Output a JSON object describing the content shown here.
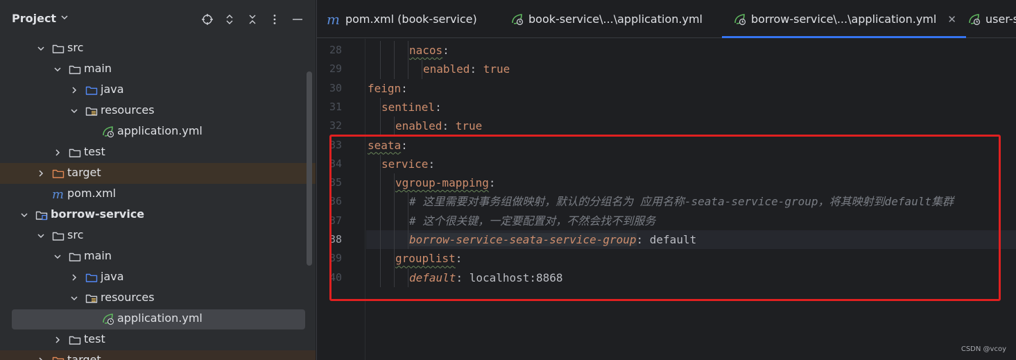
{
  "panel": {
    "title": "Project"
  },
  "tree": [
    {
      "label": "src",
      "icon": "folder-icon",
      "arrow": "down",
      "level": 3
    },
    {
      "label": "main",
      "icon": "folder-icon",
      "arrow": "down",
      "level": 4
    },
    {
      "label": "java",
      "icon": "source-folder-icon",
      "arrow": "right",
      "level": 5
    },
    {
      "label": "resources",
      "icon": "resources-folder-icon",
      "arrow": "down",
      "level": 5
    },
    {
      "label": "application.yml",
      "icon": "spring-yml-icon",
      "arrow": "none",
      "level": 6
    },
    {
      "label": "test",
      "icon": "folder-icon",
      "arrow": "right",
      "level": 4
    },
    {
      "label": "target",
      "icon": "excluded-folder-icon",
      "arrow": "right",
      "level": 3,
      "style": "target"
    },
    {
      "label": "pom.xml",
      "icon": "maven-icon",
      "arrow": "none",
      "level": 3
    },
    {
      "label": "borrow-service",
      "icon": "module-icon",
      "arrow": "down",
      "level": 2,
      "bold": true
    },
    {
      "label": "src",
      "icon": "folder-icon",
      "arrow": "down",
      "level": 3
    },
    {
      "label": "main",
      "icon": "folder-icon",
      "arrow": "down",
      "level": 4
    },
    {
      "label": "java",
      "icon": "source-folder-icon",
      "arrow": "right",
      "level": 5
    },
    {
      "label": "resources",
      "icon": "resources-folder-icon",
      "arrow": "down",
      "level": 5
    },
    {
      "label": "application.yml",
      "icon": "spring-yml-icon",
      "arrow": "none",
      "level": 6,
      "selected": true
    },
    {
      "label": "test",
      "icon": "folder-icon",
      "arrow": "right",
      "level": 4
    },
    {
      "label": "target",
      "icon": "excluded-folder-icon",
      "arrow": "right",
      "level": 3,
      "style": "target-dim"
    }
  ],
  "tabs": [
    {
      "label": "pom.xml (book-service)",
      "icon": "maven-icon"
    },
    {
      "label": "book-service\\...\\application.yml",
      "icon": "spring-yml-icon"
    },
    {
      "label": "borrow-service\\...\\application.yml",
      "icon": "spring-yml-icon",
      "active": true
    },
    {
      "label": "user-s",
      "icon": "spring-yml-icon"
    }
  ],
  "lines": [
    {
      "n": "28",
      "key": "nacos",
      "keyWavy": true,
      "indent": 3,
      "sep": ":",
      "value": ""
    },
    {
      "n": "29",
      "key": "enabled",
      "indent": 4,
      "sep": ": ",
      "value": "true"
    },
    {
      "n": "30",
      "key": "feign",
      "indent": 0,
      "sep": ":",
      "value": ""
    },
    {
      "n": "31",
      "key": "sentinel",
      "indent": 1,
      "sep": ":",
      "value": ""
    },
    {
      "n": "32",
      "key": "enabled",
      "indent": 2,
      "sep": ": ",
      "value": "true"
    },
    {
      "n": "33",
      "key": "seata",
      "keyWavy": true,
      "indent": 0,
      "sep": ":",
      "value": ""
    },
    {
      "n": "34",
      "key": "service",
      "indent": 1,
      "sep": ":",
      "value": ""
    },
    {
      "n": "35",
      "key": "vgroup-mapping",
      "keyWavy": true,
      "indent": 2,
      "sep": ":",
      "value": ""
    },
    {
      "n": "36",
      "comment": "# 这里需要对事务组做映射，默认的分组名为 应用名称-seata-service-group，将其映射到default集群",
      "indent": 3
    },
    {
      "n": "37",
      "comment": "# 这个很关键，一定要配置对，不然会找不到服务",
      "indent": 3
    },
    {
      "n": "38",
      "key": "borrow-service-seata-service-group",
      "italicKey": true,
      "indent": 3,
      "sep": ": ",
      "value": "default",
      "current": true
    },
    {
      "n": "39",
      "key": "grouplist",
      "keyWavy": true,
      "indent": 2,
      "sep": ":",
      "value": ""
    },
    {
      "n": "40",
      "key": "default",
      "italicKey": true,
      "indent": 3,
      "sep": ": ",
      "value": "localhost:8868"
    }
  ],
  "watermark": "CSDN @vcoy"
}
